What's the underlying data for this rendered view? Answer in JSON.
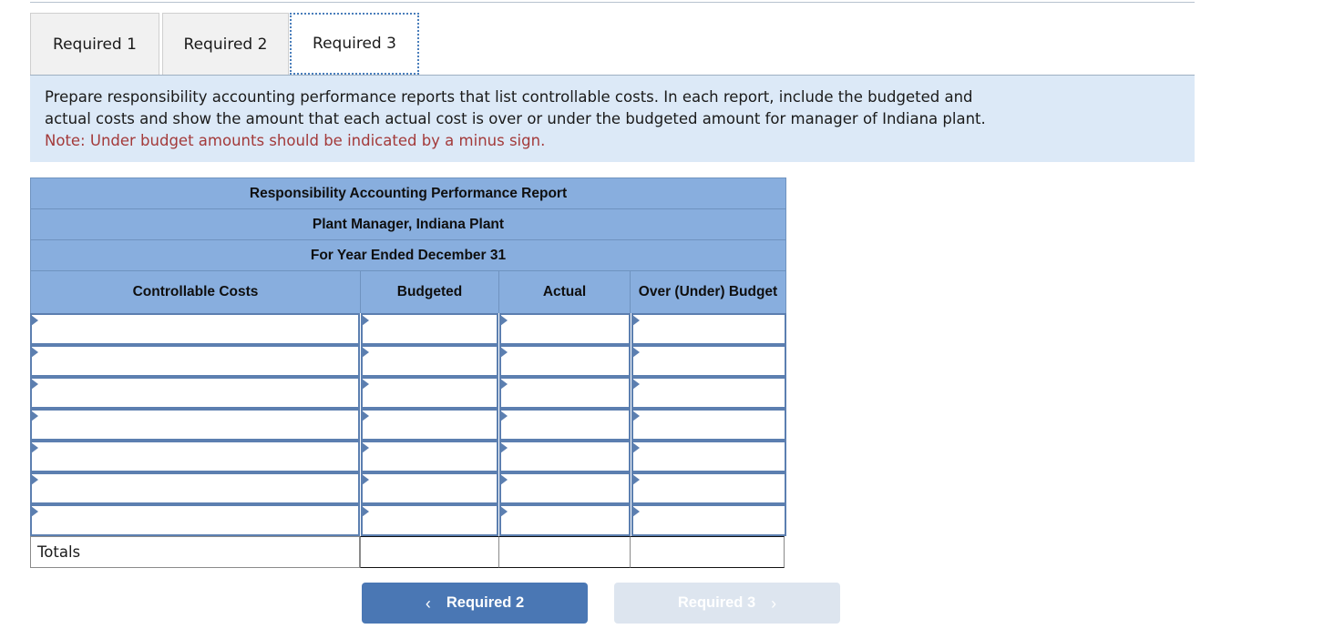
{
  "tabs": [
    {
      "label": "Required 1",
      "active": false
    },
    {
      "label": "Required 2",
      "active": false
    },
    {
      "label": "Required 3",
      "active": true
    }
  ],
  "instructions": {
    "line1": "Prepare responsibility accounting performance reports that list controllable costs. In each report, include the budgeted and",
    "line2": "actual costs and show the amount that each actual cost is over or under the budgeted amount for manager of Indiana plant.",
    "note": "Note: Under budget amounts should be indicated by a minus sign."
  },
  "report": {
    "title_line1": "Responsibility Accounting Performance Report",
    "title_line2": "Plant Manager, Indiana Plant",
    "title_line3": "For Year Ended December 31",
    "columns": [
      "Controllable Costs",
      "Budgeted",
      "Actual",
      "Over (Under) Budget"
    ],
    "rows": [
      {
        "cost": "",
        "budgeted": "",
        "actual": "",
        "over_under": ""
      },
      {
        "cost": "",
        "budgeted": "",
        "actual": "",
        "over_under": ""
      },
      {
        "cost": "",
        "budgeted": "",
        "actual": "",
        "over_under": ""
      },
      {
        "cost": "",
        "budgeted": "",
        "actual": "",
        "over_under": ""
      },
      {
        "cost": "",
        "budgeted": "",
        "actual": "",
        "over_under": ""
      },
      {
        "cost": "",
        "budgeted": "",
        "actual": "",
        "over_under": ""
      },
      {
        "cost": "",
        "budgeted": "",
        "actual": "",
        "over_under": ""
      }
    ],
    "totals": {
      "label": "Totals",
      "budgeted": "",
      "actual": "",
      "over_under": ""
    }
  },
  "navigation": {
    "prev_label": "Required 2",
    "prev_icon": "chevron-left-icon",
    "prev_chevron": "‹",
    "next_label": "Required 3",
    "next_icon": "chevron-right-icon",
    "next_chevron": "›",
    "next_disabled": true
  },
  "colors": {
    "header_blue": "#88aede",
    "instruction_bg": "#dce9f7",
    "note_red": "#a33a3a",
    "cell_border_blue": "#5c7fb0",
    "button_active": "#4a77b4",
    "button_disabled": "#dde5ef"
  }
}
